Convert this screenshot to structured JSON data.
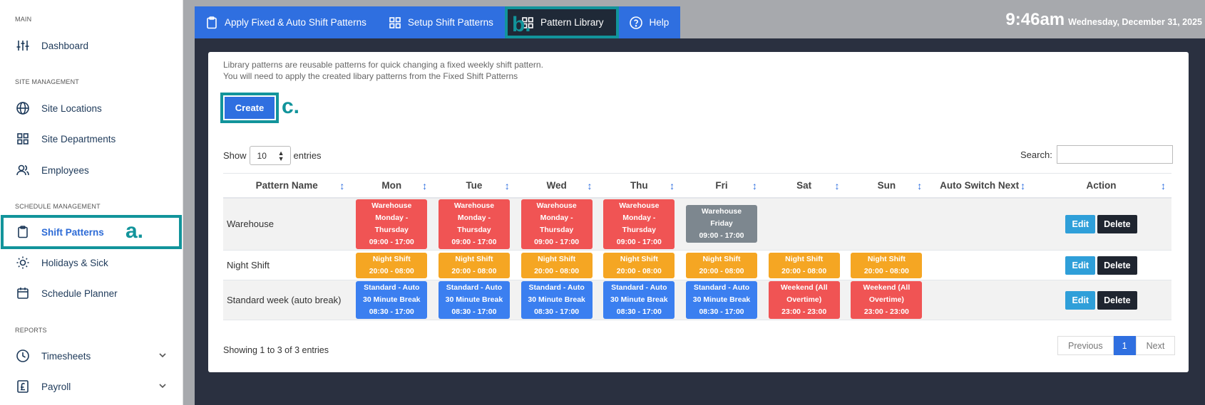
{
  "sidebar": {
    "sections": {
      "main": "MAIN",
      "site": "SITE MANAGEMENT",
      "schedule": "SCHEDULE MANAGEMENT",
      "reports": "REPORTS"
    },
    "items": {
      "dashboard": "Dashboard",
      "site_locations": "Site Locations",
      "site_departments": "Site Departments",
      "employees": "Employees",
      "shift_patterns": "Shift Patterns",
      "holidays": "Holidays & Sick",
      "schedule_planner": "Schedule Planner",
      "timesheets": "Timesheets",
      "payroll": "Payroll"
    },
    "annotation": "a."
  },
  "tabs": {
    "apply": "Apply Fixed & Auto Shift Patterns",
    "setup": "Setup Shift Patterns",
    "library": "Pattern Library",
    "help": "Help",
    "annotation": "b."
  },
  "clock": {
    "time": "9:46am",
    "date": "Wednesday, December 31, 2025"
  },
  "intro": {
    "line1": "Library patterns are reusable patterns for quick changing a fixed weekly shift pattern.",
    "line2": "You will need to apply the created libary patterns from the Fixed Shift Patterns"
  },
  "create": {
    "label": "Create",
    "annotation": "c."
  },
  "controls": {
    "show": "Show",
    "entries_value": "10",
    "entries": "entries",
    "search": "Search:"
  },
  "table": {
    "headers": [
      "Pattern Name",
      "Mon",
      "Tue",
      "Wed",
      "Thu",
      "Fri",
      "Sat",
      "Sun",
      "Auto Switch Next",
      "Action"
    ],
    "rows": [
      {
        "name": "Warehouse",
        "days": [
          {
            "color": "red",
            "lines": [
              "Warehouse",
              "Monday -",
              "Thursday",
              "09:00 - 17:00"
            ]
          },
          {
            "color": "red",
            "lines": [
              "Warehouse",
              "Monday -",
              "Thursday",
              "09:00 - 17:00"
            ]
          },
          {
            "color": "red",
            "lines": [
              "Warehouse",
              "Monday -",
              "Thursday",
              "09:00 - 17:00"
            ]
          },
          {
            "color": "red",
            "lines": [
              "Warehouse",
              "Monday -",
              "Thursday",
              "09:00 - 17:00"
            ]
          },
          {
            "color": "grey",
            "lines": [
              "Warehouse",
              "Friday",
              "09:00 - 17:00"
            ]
          },
          null,
          null
        ]
      },
      {
        "name": "Night Shift",
        "days": [
          {
            "color": "orange",
            "lines": [
              "Night Shift",
              "20:00 - 08:00"
            ]
          },
          {
            "color": "orange",
            "lines": [
              "Night Shift",
              "20:00 - 08:00"
            ]
          },
          {
            "color": "orange",
            "lines": [
              "Night Shift",
              "20:00 - 08:00"
            ]
          },
          {
            "color": "orange",
            "lines": [
              "Night Shift",
              "20:00 - 08:00"
            ]
          },
          {
            "color": "orange",
            "lines": [
              "Night Shift",
              "20:00 - 08:00"
            ]
          },
          {
            "color": "orange",
            "lines": [
              "Night Shift",
              "20:00 - 08:00"
            ]
          },
          {
            "color": "orange",
            "lines": [
              "Night Shift",
              "20:00 - 08:00"
            ]
          }
        ]
      },
      {
        "name": "Standard week (auto break)",
        "days": [
          {
            "color": "blue",
            "lines": [
              "Standard - Auto",
              "30 Minute Break",
              "08:30 - 17:00"
            ]
          },
          {
            "color": "blue",
            "lines": [
              "Standard - Auto",
              "30 Minute Break",
              "08:30 - 17:00"
            ]
          },
          {
            "color": "blue",
            "lines": [
              "Standard - Auto",
              "30 Minute Break",
              "08:30 - 17:00"
            ]
          },
          {
            "color": "blue",
            "lines": [
              "Standard - Auto",
              "30 Minute Break",
              "08:30 - 17:00"
            ]
          },
          {
            "color": "blue",
            "lines": [
              "Standard - Auto",
              "30 Minute Break",
              "08:30 - 17:00"
            ]
          },
          {
            "color": "red",
            "lines": [
              "Weekend (All",
              "Overtime)",
              "23:00 - 23:00"
            ]
          },
          {
            "color": "red",
            "lines": [
              "Weekend (All",
              "Overtime)",
              "23:00 - 23:00"
            ]
          }
        ]
      }
    ],
    "edit_label": "Edit",
    "delete_label": "Delete"
  },
  "footer": {
    "showing": "Showing 1 to 3 of 3 entries",
    "previous": "Previous",
    "page": "1",
    "next": "Next"
  },
  "colors": {
    "accent": "#2f6fe0",
    "annotation": "#12949b",
    "red": "#f05454",
    "orange": "#f5a623",
    "blue": "#3b7ff0",
    "grey": "#7d878f"
  }
}
